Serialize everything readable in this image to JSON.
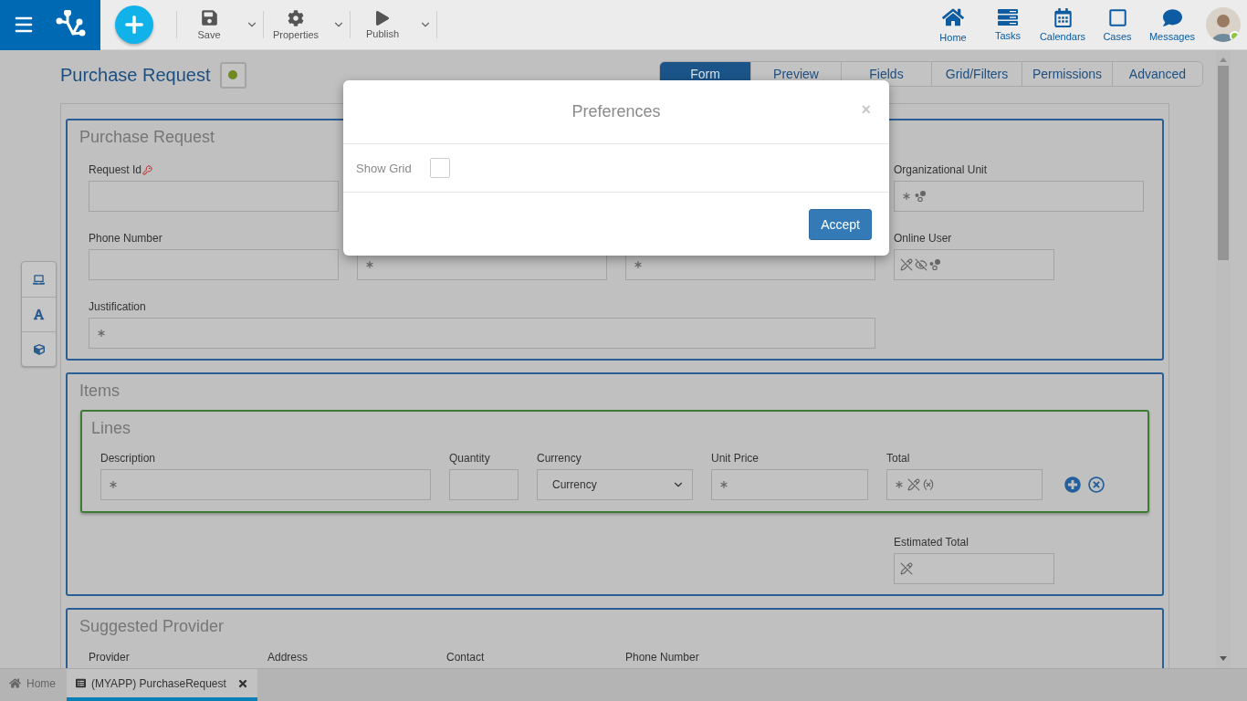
{
  "toolbar": {
    "actions": [
      {
        "label": "Save",
        "kind": "save"
      },
      {
        "label": "Properties",
        "kind": "properties"
      },
      {
        "label": "Publish",
        "kind": "publish"
      }
    ],
    "nav": [
      {
        "label": "Home",
        "kind": "home"
      },
      {
        "label": "Tasks",
        "kind": "tasks"
      },
      {
        "label": "Calendars",
        "kind": "calendars"
      },
      {
        "label": "Cases",
        "kind": "cases"
      },
      {
        "label": "Messages",
        "kind": "messages"
      }
    ],
    "user_online": true
  },
  "page": {
    "title": "Purchase Request"
  },
  "tabs": [
    {
      "label": "Form",
      "selected": true
    },
    {
      "label": "Preview",
      "selected": false
    },
    {
      "label": "Fields",
      "selected": false
    },
    {
      "label": "Grid/Filters",
      "selected": false
    },
    {
      "label": "Permissions",
      "selected": false
    },
    {
      "label": "Advanced",
      "selected": false
    }
  ],
  "sections": [
    {
      "title": "Purchase Request",
      "fields": [
        {
          "label": "Request Id",
          "key": true
        },
        {
          "label": "Organizational Unit",
          "required": true,
          "linked": true
        },
        {
          "label": "Phone Number"
        },
        {
          "required": true
        },
        {
          "required": true
        },
        {
          "label": "Online User",
          "read_only": true,
          "hidden": true,
          "linked": true
        },
        {
          "label": "Justification",
          "required": true
        }
      ]
    },
    {
      "title": "Items",
      "grid": {
        "title": "Lines",
        "fields": [
          {
            "label": "Description",
            "required": true
          },
          {
            "label": "Quantity"
          },
          {
            "label": "Currency",
            "kind": "select",
            "value": "Currency"
          },
          {
            "label": "Unit Price",
            "required": true
          },
          {
            "label": "Total",
            "required": true,
            "read_only": true,
            "formula": true
          }
        ]
      },
      "fields": [
        {
          "label": "Estimated Total",
          "read_only": true
        }
      ]
    },
    {
      "title": "Suggested Provider",
      "fields": [
        {
          "label": "Provider"
        },
        {
          "label": "Address"
        },
        {
          "label": "Contact"
        },
        {
          "label": "Phone Number"
        }
      ]
    }
  ],
  "dialog": {
    "title": "Preferences",
    "close": "×",
    "options": [
      {
        "label": "Show Grid",
        "checked": false
      }
    ],
    "button": "Accept"
  },
  "bottom_tabs": [
    {
      "label": "Home",
      "kind": "home",
      "selected": false
    },
    {
      "label": "(MYAPP) PurchaseRequest",
      "kind": "form",
      "selected": true
    }
  ]
}
